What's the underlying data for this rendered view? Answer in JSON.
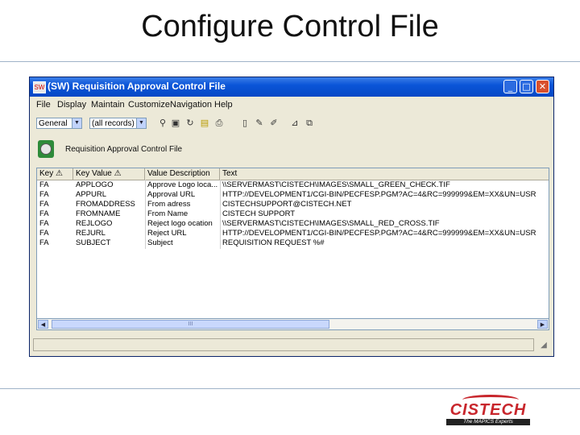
{
  "slide": {
    "title": "Configure Control File"
  },
  "window": {
    "icon_text": "SW",
    "title": "(SW) Requisition Approval Control File",
    "controls": {
      "minimize": "_",
      "maximize": "□",
      "close": "✕"
    }
  },
  "menu": [
    "File",
    "Display",
    "Maintain",
    "Customize",
    "Navigation",
    "Help"
  ],
  "toolbar": {
    "view_select": "General",
    "filter_select": "(all records)",
    "icons": [
      "binoculars-icon",
      "find-icon",
      "refresh-icon",
      "note-icon",
      "print-icon",
      "new-icon",
      "edit-icon",
      "edit-pencil-icon",
      "filter-icon",
      "copy-icon"
    ]
  },
  "header": {
    "label": "Requisition Approval Control File"
  },
  "grid": {
    "columns": [
      "Key",
      "Key Value",
      "Value Description",
      "Text"
    ],
    "rows": [
      [
        "FA",
        "APPLOGO",
        "Approve Logo loca...",
        "\\\\SERVERMAST\\CISTECH\\IMAGES\\SMALL_GREEN_CHECK.TIF"
      ],
      [
        "FA",
        "APPURL",
        "Approval URL",
        "HTTP://DEVELOPMENT1/CGI-BIN/PECFESP.PGM?AC=4&RC=999999&EM=XX&UN=USR"
      ],
      [
        "FA",
        "FROMADDRESS",
        "From adress",
        "CISTECHSUPPORT@CISTECH.NET"
      ],
      [
        "FA",
        "FROMNAME",
        "From Name",
        "CISTECH SUPPORT"
      ],
      [
        "FA",
        "REJLOGO",
        "Reject logo ocation",
        "\\\\SERVERMAST\\CISTECH\\IMAGES\\SMALL_RED_CROSS.TIF"
      ],
      [
        "FA",
        "REJURL",
        "Reject URL",
        "HTTP://DEVELOPMENT1/CGI-BIN/PECFESP.PGM?AC=4&RC=999999&EM=XX&UN=USR"
      ],
      [
        "FA",
        "SUBJECT",
        "Subject",
        "REQUISITION REQUEST %#"
      ]
    ]
  },
  "scrollbar": {
    "thumb_grip": "III"
  },
  "logo": {
    "name": "CISTECH",
    "tagline": "The MAPICS Experts"
  },
  "colors": {
    "titlebar": "#0a55d8",
    "brand_red": "#c8262c",
    "close_button": "#d9502c"
  }
}
